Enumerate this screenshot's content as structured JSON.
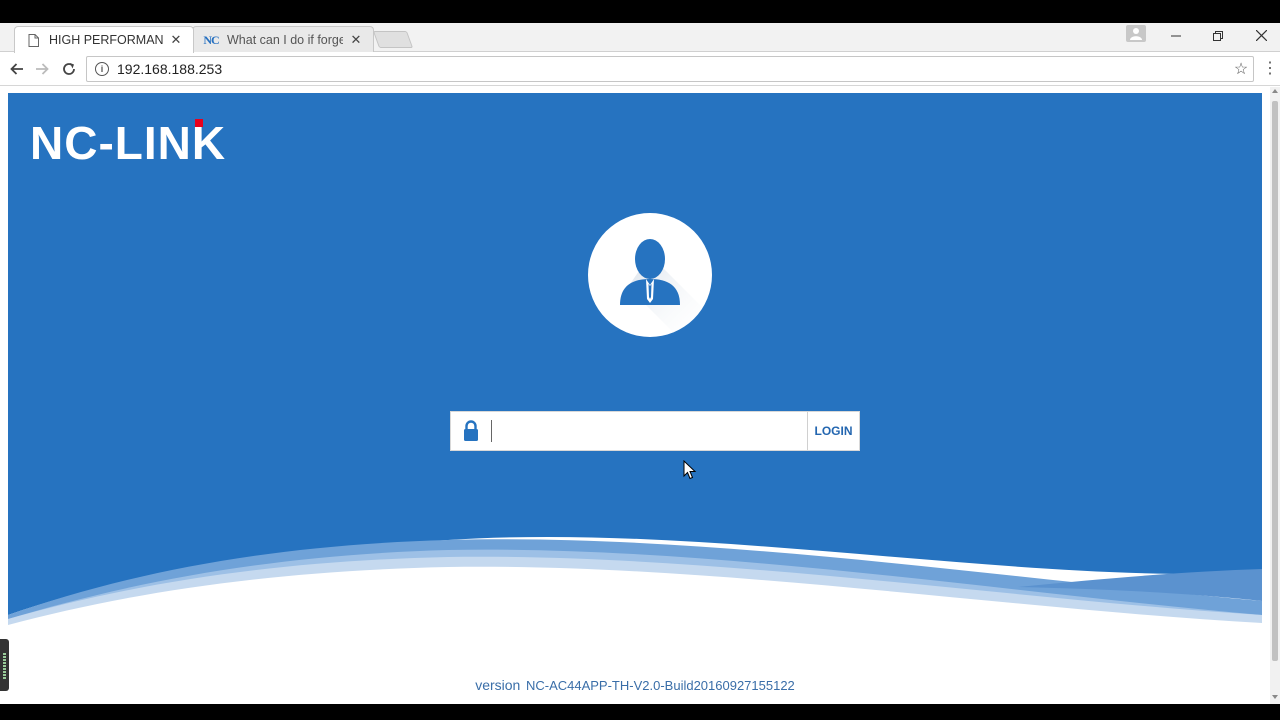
{
  "browser": {
    "tabs": [
      {
        "title": "HIGH PERFORMANCE |",
        "favicon": "page-icon",
        "active": true
      },
      {
        "title": "What can I do if forget",
        "favicon_text": "NC",
        "active": false
      }
    ],
    "address": "192.168.188.253"
  },
  "page": {
    "brand": "NC-LINK",
    "brand_color": "#2673c0",
    "brand_dot_color": "#e8001c",
    "login": {
      "password_value": "",
      "button_label": "LOGIN"
    },
    "footer": {
      "version_label": "version",
      "version_value": "NC-AC44APP-TH-V2.0-Build20160927155122"
    }
  }
}
